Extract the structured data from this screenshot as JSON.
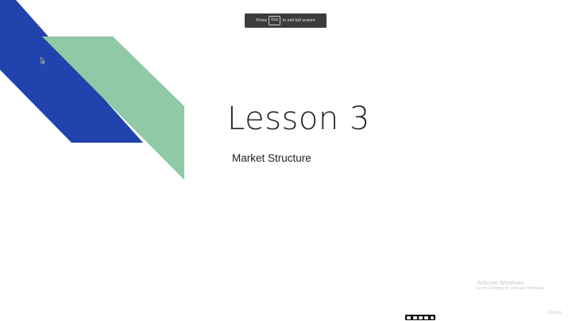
{
  "fullscreen_banner": {
    "prefix": "Press",
    "key": "Esc",
    "suffix": "to exit full screen"
  },
  "slide": {
    "title": "Lesson 3",
    "subtitle": "Market Structure",
    "colors": {
      "blue": "#2143ad",
      "green": "#8fc9a6",
      "background": "#ffffff"
    }
  },
  "watermark": {
    "title": "Activate Windows",
    "subtitle": "Go to Settings to activate Windows."
  },
  "player": {
    "controls": [
      "captions-icon",
      "transcript-icon",
      "notes-icon",
      "fullscreen-icon",
      "settings-icon"
    ]
  },
  "brand": {
    "label": "Udemy"
  }
}
